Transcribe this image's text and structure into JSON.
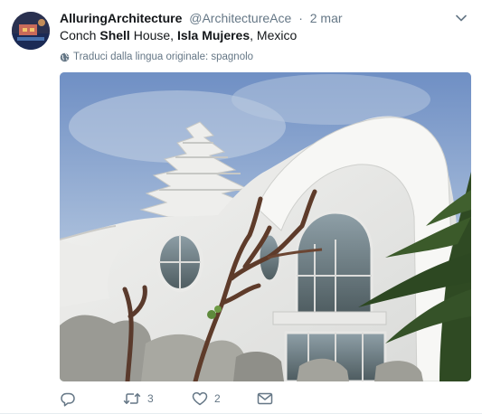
{
  "tweet": {
    "display_name": "AlluringArchitecture",
    "handle": "@ArchitectureAce",
    "separator": "·",
    "date": "2 mar",
    "text_parts": [
      "Conch ",
      "Shell",
      " House, ",
      "Isla Mujeres",
      ", Mexico"
    ],
    "translate_label": "Traduci dalla lingua originale: spagnolo",
    "actions": {
      "retweet_count": "3",
      "like_count": "2"
    }
  },
  "icons": {
    "menu": "chevron-down-icon",
    "translate": "globe-icon",
    "reply": "reply-icon",
    "retweet": "retweet-icon",
    "like": "heart-icon",
    "message": "envelope-icon"
  },
  "colors": {
    "text_primary": "#14171a",
    "text_secondary": "#657786",
    "background": "#ffffff"
  }
}
